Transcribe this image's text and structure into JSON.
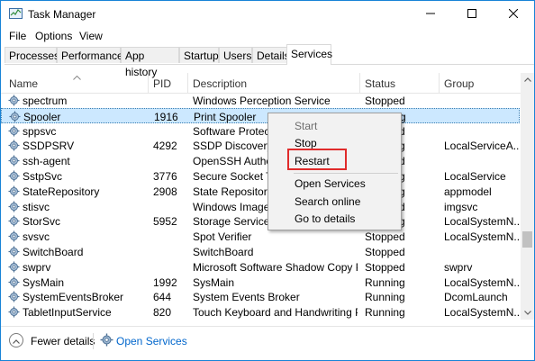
{
  "window": {
    "title": "Task Manager",
    "minimize_label": "minimize",
    "maximize_label": "maximize",
    "close_label": "close"
  },
  "menu": [
    "File",
    "Options",
    "View"
  ],
  "tabs": [
    "Processes",
    "Performance",
    "App history",
    "Startup",
    "Users",
    "Details",
    "Services"
  ],
  "active_tab": "Services",
  "columns": [
    "Name",
    "PID",
    "Description",
    "Status",
    "Group"
  ],
  "rows": [
    {
      "name": "spectrum",
      "pid": "",
      "description": "Windows Perception Service",
      "status": "Stopped",
      "group": ""
    },
    {
      "name": "Spooler",
      "pid": "1916",
      "description": "Print Spooler",
      "status": "Running",
      "group": ""
    },
    {
      "name": "sppsvc",
      "pid": "",
      "description": "Software Protection",
      "status": "Stopped",
      "group": ""
    },
    {
      "name": "SSDPSRV",
      "pid": "4292",
      "description": "SSDP Discovery",
      "status": "Running",
      "group": "LocalServiceA..."
    },
    {
      "name": "ssh-agent",
      "pid": "",
      "description": "OpenSSH Authentication Agent",
      "status": "Stopped",
      "group": ""
    },
    {
      "name": "SstpSvc",
      "pid": "3776",
      "description": "Secure Socket Tunneling Protocol Service",
      "status": "Running",
      "group": "LocalService"
    },
    {
      "name": "StateRepository",
      "pid": "2908",
      "description": "State Repository Service",
      "status": "Running",
      "group": "appmodel"
    },
    {
      "name": "stisvc",
      "pid": "",
      "description": "Windows Image Acquisition (WIA)",
      "status": "Stopped",
      "group": "imgsvc"
    },
    {
      "name": "StorSvc",
      "pid": "5952",
      "description": "Storage Service",
      "status": "Running",
      "group": "LocalSystemN..."
    },
    {
      "name": "svsvc",
      "pid": "",
      "description": "Spot Verifier",
      "status": "Stopped",
      "group": "LocalSystemN..."
    },
    {
      "name": "SwitchBoard",
      "pid": "",
      "description": "SwitchBoard",
      "status": "Stopped",
      "group": ""
    },
    {
      "name": "swprv",
      "pid": "",
      "description": "Microsoft Software Shadow Copy Pr...",
      "status": "Stopped",
      "group": "swprv"
    },
    {
      "name": "SysMain",
      "pid": "1992",
      "description": "SysMain",
      "status": "Running",
      "group": "LocalSystemN..."
    },
    {
      "name": "SystemEventsBroker",
      "pid": "644",
      "description": "System Events Broker",
      "status": "Running",
      "group": "DcomLaunch"
    },
    {
      "name": "TabletInputService",
      "pid": "820",
      "description": "Touch Keyboard and Handwriting P...",
      "status": "Running",
      "group": "LocalSystemN..."
    }
  ],
  "selected_row": "Spooler",
  "context_menu": {
    "start": "Start",
    "stop": "Stop",
    "restart": "Restart",
    "open_services": "Open Services",
    "search_online": "Search online",
    "go_to_details": "Go to details"
  },
  "footer": {
    "fewer_details": "Fewer details",
    "open_services": "Open Services"
  },
  "colors": {
    "accent": "#1883d7",
    "selection": "#cce8ff",
    "highlight": "#e02b2b",
    "link": "#0066cc"
  }
}
